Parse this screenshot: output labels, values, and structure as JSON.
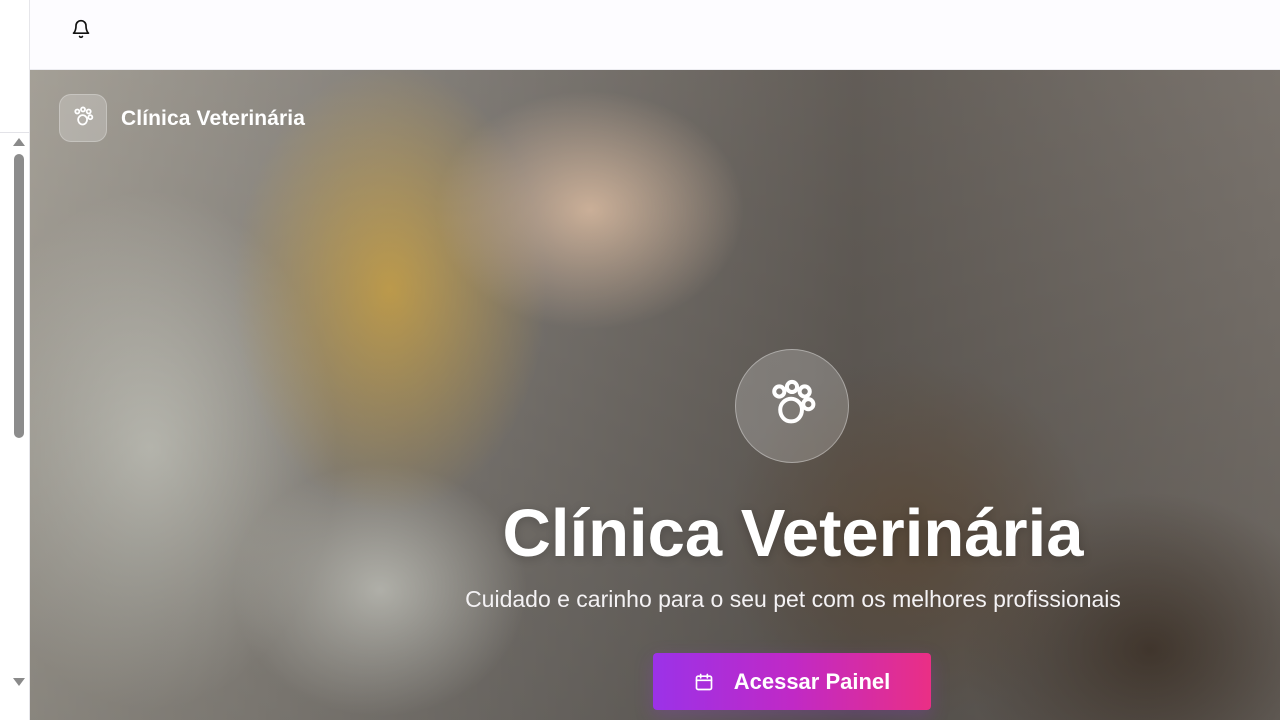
{
  "sidebar": {
    "scroll_up_icon": "triangle-up",
    "scroll_down_icon": "triangle-down"
  },
  "topbar": {
    "notification_icon": "bell-icon"
  },
  "hero": {
    "brand_title": "Clínica Veterinária",
    "logo_icon": "paw-icon",
    "center_icon": "paw-icon",
    "title": "Clínica Veterinária",
    "subtitle": "Cuidado e carinho para o seu pet com os melhores profissionais",
    "cta_label": "Acessar Painel",
    "cta_icon": "calendar-icon"
  },
  "colors": {
    "accent_start": "#9B32E8",
    "accent_end": "#EA2F85",
    "white": "#FFFFFF"
  }
}
